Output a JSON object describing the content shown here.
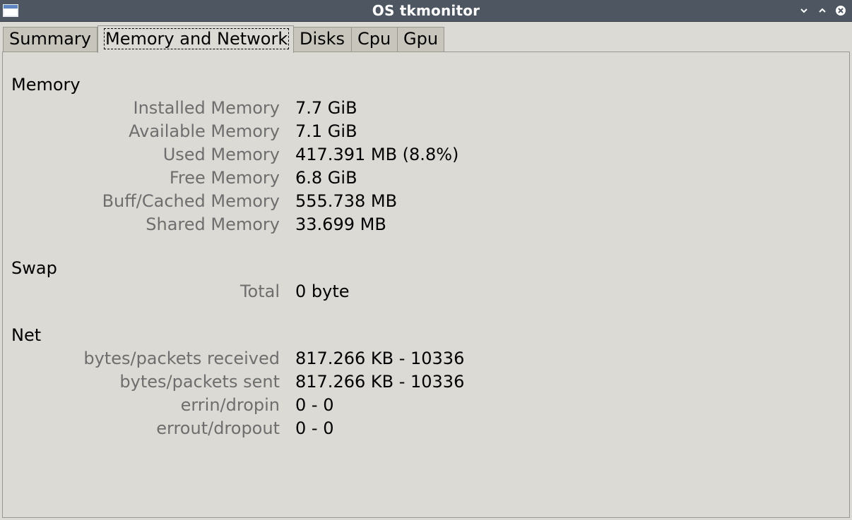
{
  "window": {
    "title": "OS tkmonitor",
    "controls": [
      "minimize-icon",
      "maximize-icon",
      "close-icon"
    ]
  },
  "tabs": [
    {
      "label": "Summary"
    },
    {
      "label": "Memory and Network",
      "active": true
    },
    {
      "label": "Disks"
    },
    {
      "label": "Cpu"
    },
    {
      "label": "Gpu"
    }
  ],
  "memory": {
    "title": "Memory",
    "rows": [
      {
        "label": "Installed Memory",
        "value": "7.7 GiB"
      },
      {
        "label": "Available Memory",
        "value": "7.1 GiB"
      },
      {
        "label": "Used Memory",
        "value": "417.391 MB (8.8%)"
      },
      {
        "label": "Free Memory",
        "value": "6.8 GiB"
      },
      {
        "label": "Buff/Cached Memory",
        "value": "555.738 MB"
      },
      {
        "label": "Shared Memory",
        "value": "33.699 MB"
      }
    ]
  },
  "swap": {
    "title": "Swap",
    "rows": [
      {
        "label": "Total",
        "value": "0 byte"
      }
    ]
  },
  "net": {
    "title": "Net",
    "rows": [
      {
        "label": "bytes/packets received",
        "value": "817.266 KB - 10336"
      },
      {
        "label": "bytes/packets sent",
        "value": "817.266 KB - 10336"
      },
      {
        "label": "errin/dropin",
        "value": "0 - 0"
      },
      {
        "label": "errout/dropout",
        "value": "0 - 0"
      }
    ]
  },
  "colors": {
    "titlebar": "#4d5661",
    "background": "#dcdad5",
    "label_text": "#6e6e6e",
    "value_text": "#000000"
  }
}
